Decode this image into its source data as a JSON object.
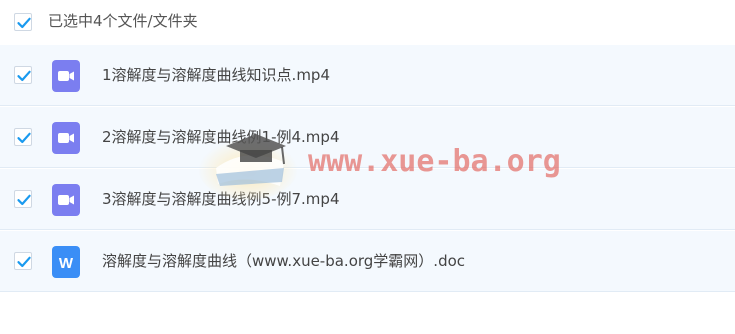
{
  "header": {
    "selection_text": "已选中4个文件/文件夹"
  },
  "files": [
    {
      "name": "1溶解度与溶解度曲线知识点.mp4",
      "type": "video",
      "icon": "video-file-icon"
    },
    {
      "name": "2溶解度与溶解度曲线例1-例4.mp4",
      "type": "video",
      "icon": "video-file-icon"
    },
    {
      "name": "3溶解度与溶解度曲线例5-例7.mp4",
      "type": "video",
      "icon": "video-file-icon"
    },
    {
      "name": "溶解度与溶解度曲线（www.xue-ba.org学霸网）.doc",
      "type": "doc",
      "icon": "word-file-icon",
      "icon_letter": "W"
    }
  ],
  "watermark": {
    "text": "www.xue-ba.org"
  },
  "colors": {
    "check": "#1a9aef",
    "row_background": "#f4f9fe",
    "video_icon": "#7b7ef0",
    "doc_icon": "#3a8ef6",
    "watermark": "#e15850"
  }
}
